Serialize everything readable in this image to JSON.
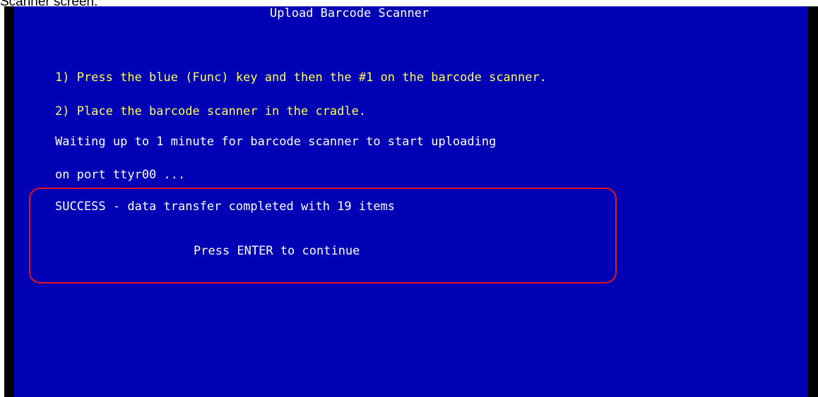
{
  "caption": "Scanner screen.",
  "terminal": {
    "title": "Upload Barcode Scanner",
    "step1": "1) Press the blue (Func) key and then the #1 on the barcode scanner.",
    "step2": "2) Place the barcode scanner in the cradle.",
    "waiting_line1": "Waiting up to 1 minute for barcode scanner to start uploading",
    "waiting_line2": "on port ttyr00 ...",
    "success_message": "SUCCESS - data transfer completed with 19 items",
    "continue_prompt": "Press ENTER to continue"
  },
  "colors": {
    "background": "#0000b4",
    "instruction_text": "#ffff55",
    "status_text": "#ffffff",
    "highlight_border": "#e0141e"
  }
}
